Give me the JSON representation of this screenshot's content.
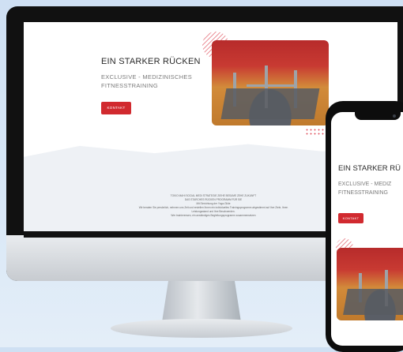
{
  "site": {
    "hero_title": "EIN STARKER RÜCKEN",
    "hero_subtitle": "EXCLUSIVE - MEDIZINISCHES FITNESSTRAINING",
    "contact_button": "KONTAKT",
    "footer_lines": [
      "TOKIO MAHI SOCIAL MEDI STRATEGIE ZIEHE BESUME ZEHE ZUKUNFT",
      "DAS STARCHES RÜCKEN PROGRAMM FÜR SIE",
      "Mit Einrichtung der Yoga-Gilde",
      "Wir beraten Sie persönlich, nehmen uns Zeit und erstellen Ihnen ein individuelles Trainingsprogramm abgestimmt auf Ihre Ziele, Ihren",
      "Leistungsstand und Ihre Beschwerden.",
      "Wer trainierensen, ein anständiges Begleitungsprogramm zusammensetzen"
    ]
  },
  "phone": {
    "hero_title": "EIN STARKER RÜ",
    "hero_subtitle_line1": "EXCLUSIVE - MEDIZ",
    "hero_subtitle_line2": "FITNESSTRAINING",
    "contact_button": "KONTAKT"
  },
  "colors": {
    "accent_red": "#d12a2f",
    "background_blue": "#d8e7f6",
    "frame_black": "#111111"
  }
}
